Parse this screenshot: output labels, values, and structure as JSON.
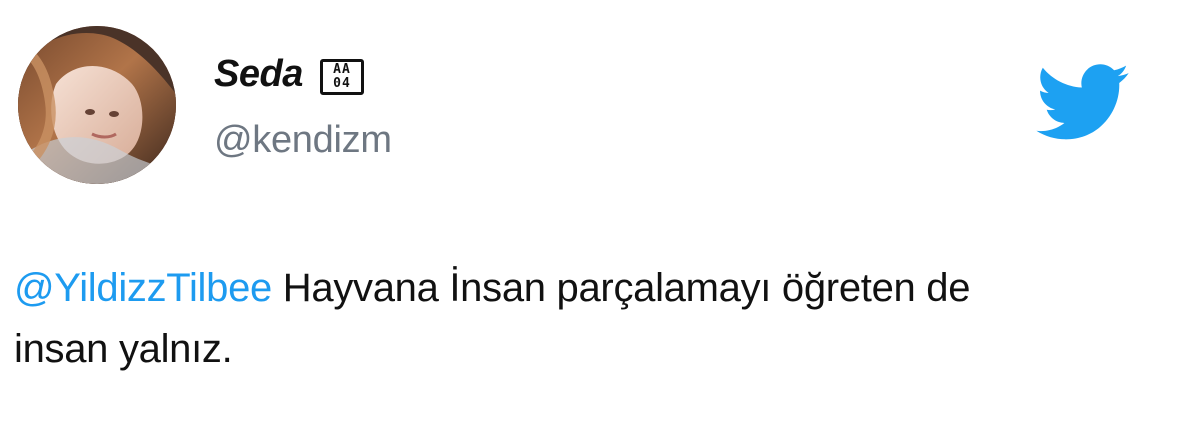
{
  "tweet": {
    "display_name": "Seda",
    "badge": "AA\n04",
    "username": "@kendizm",
    "mention": "@YildizzTilbee",
    "text_after_mention": " Hayvana İnsan parçalamayı öğreten de insan yalnız."
  },
  "icons": {
    "brand_logo": "twitter-bird-icon",
    "avatar": "profile-avatar"
  },
  "colors": {
    "mention": "#1d9bf0",
    "username": "#6e7782",
    "brand": "#1da1f2"
  }
}
